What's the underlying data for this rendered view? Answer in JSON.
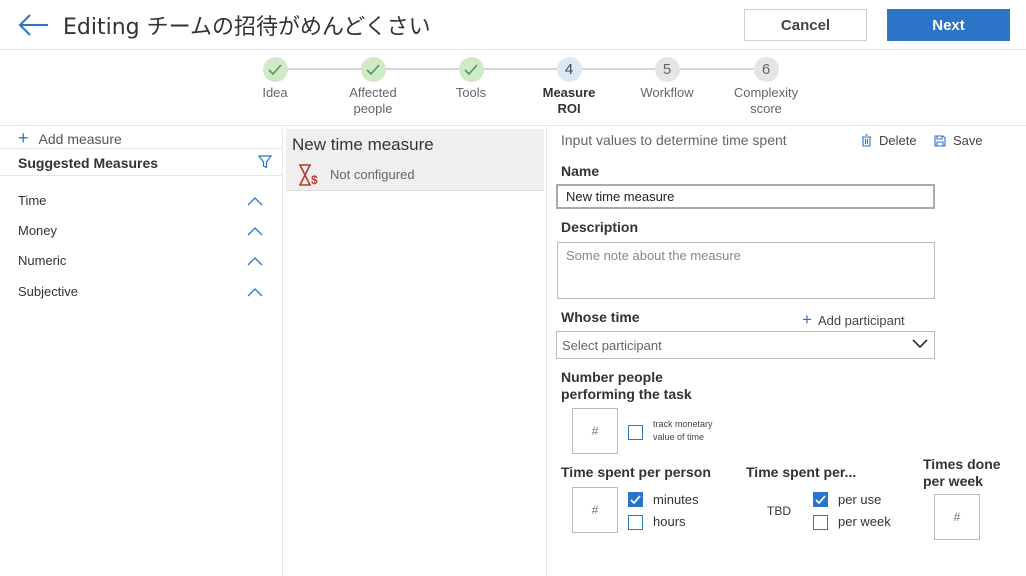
{
  "header": {
    "title": "Editing チームの招待がめんどくさい",
    "cancel_label": "Cancel",
    "next_label": "Next"
  },
  "stepper": {
    "steps": [
      {
        "number": "1",
        "label": "Idea",
        "state": "done"
      },
      {
        "number": "2",
        "label": "Affected people",
        "state": "done"
      },
      {
        "number": "3",
        "label": "Tools",
        "state": "done"
      },
      {
        "number": "4",
        "label": "Measure ROI",
        "state": "current"
      },
      {
        "number": "5",
        "label": "Workflow",
        "state": "todo"
      },
      {
        "number": "6",
        "label": "Complexity score",
        "state": "todo"
      }
    ]
  },
  "left": {
    "add_measure_label": "Add measure",
    "suggested_title": "Suggested Measures",
    "categories": [
      "Time",
      "Money",
      "Numeric",
      "Subjective"
    ]
  },
  "middle": {
    "measure_name": "New time measure",
    "measure_status": "Not configured"
  },
  "form": {
    "hint": "Input values to determine time spent",
    "delete_label": "Delete",
    "save_label": "Save",
    "name_label": "Name",
    "name_value": "New time measure",
    "description_label": "Description",
    "description_placeholder": "Some note about the measure",
    "whose_time_label": "Whose time",
    "add_participant_label": "Add participant",
    "participant_placeholder": "Select participant",
    "people_label_line1": "Number people",
    "people_label_line2": "performing the task",
    "people_placeholder": "#",
    "track_monetary_line1": "track monetary",
    "track_monetary_line2": "value of time",
    "track_monetary_checked": false,
    "time_per_person_label": "Time spent per person",
    "time_per_person_placeholder": "#",
    "minutes_label": "minutes",
    "minutes_checked": true,
    "hours_label": "hours",
    "hours_checked": false,
    "time_per_label": "Time spent per...",
    "tbd_label": "TBD",
    "per_use_label": "per use",
    "per_use_checked": true,
    "per_week_label": "per week",
    "per_week_checked": false,
    "times_done_line1": "Times done",
    "times_done_line2": "per week",
    "times_done_placeholder": "#"
  },
  "colors": {
    "accent": "#2b74c7",
    "done_step": "#cfe9c9",
    "current_step": "#dbe8f5",
    "status_icon": "#c0392b"
  }
}
